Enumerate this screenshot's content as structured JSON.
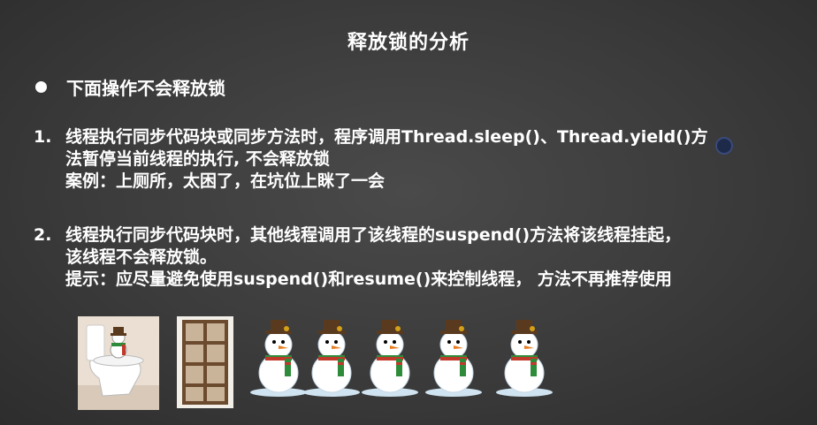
{
  "slide": {
    "title": "释放锁的分析",
    "bullet": "下面操作不会释放锁",
    "items": [
      {
        "number": "1.",
        "line1": "线程执行同步代码块或同步方法时，程序调用Thread.sleep()、Thread.yield()方",
        "line2": "法暂停当前线程的执行, 不会释放锁",
        "note": "案例：上厕所，太困了，在坑位上眯了一会"
      },
      {
        "number": "2.",
        "line1": "线程执行同步代码块时，其他线程调用了该线程的suspend()方法将该线程挂起，",
        "line2": "该线程不会释放锁。",
        "note": "提示：应尽量避免使用suspend()和resume()来控制线程， 方法不再推荐使用"
      }
    ]
  },
  "images": {
    "toilet_icon": "toilet-with-snowman-icon",
    "door_icon": "stall-door-icon",
    "snowman_icon": "snowman-icon",
    "snowman_count": 5
  },
  "colors": {
    "background": "#3b3b3b",
    "text": "#ffffff"
  }
}
